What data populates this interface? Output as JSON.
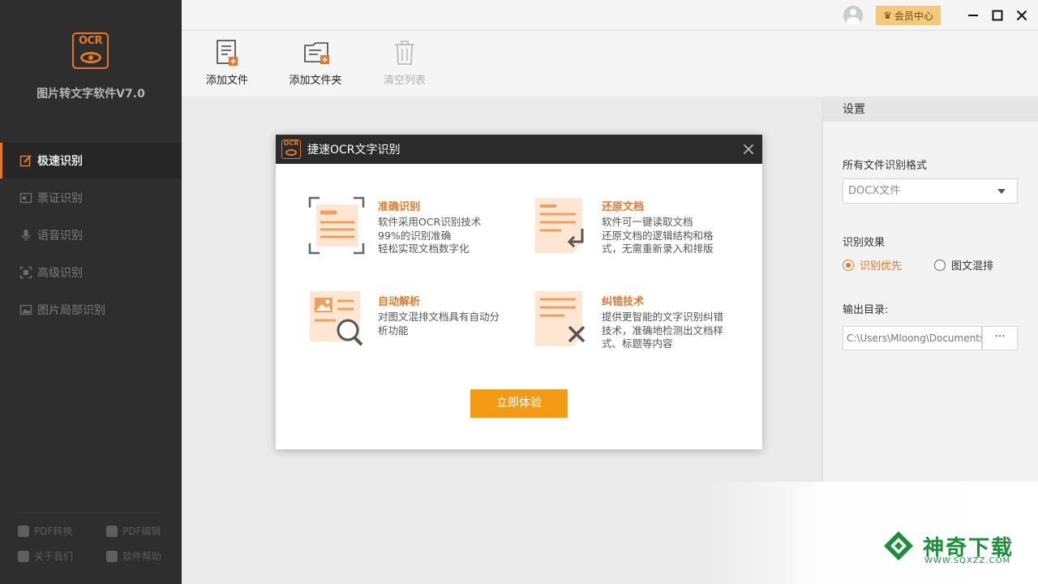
{
  "app": {
    "logo_text": "OCR",
    "name": "图片转文字软件V7.0"
  },
  "sidebar": {
    "items": [
      {
        "label": "极速识别",
        "icon": "fast-recognize-icon",
        "active": true
      },
      {
        "label": "票证识别",
        "icon": "ticket-icon",
        "active": false
      },
      {
        "label": "语音识别",
        "icon": "microphone-icon",
        "active": false
      },
      {
        "label": "高级识别",
        "icon": "advanced-icon",
        "active": false
      },
      {
        "label": "图片局部识别",
        "icon": "image-region-icon",
        "active": false
      }
    ],
    "bottom_links": [
      {
        "label": "PDF转换",
        "icon": "pdf-convert-icon"
      },
      {
        "label": "PDF编辑",
        "icon": "pdf-edit-icon"
      },
      {
        "label": "关于我们",
        "icon": "about-icon"
      },
      {
        "label": "软件帮助",
        "icon": "help-icon"
      }
    ]
  },
  "titlebar": {
    "member_label": "会员中心",
    "minimize": "—",
    "maximize": "□",
    "close": "✕"
  },
  "toolbar": {
    "add_file": "添加文件",
    "add_folder": "添加文件夹",
    "clear_list": "清空列表"
  },
  "settings": {
    "header": "设置",
    "format_label": "所有文件识别格式",
    "format_value": "DOCX文件",
    "effect_label": "识别效果",
    "effect_options": [
      "识别优先",
      "图文混排"
    ],
    "effect_selected": "识别优先",
    "output_label": "输出目录:",
    "output_path": "C:\\Users\\Mloong\\Documents",
    "browse_label": "···"
  },
  "dialog": {
    "logo_text": "OCR",
    "title": "捷速OCR文字识别",
    "features": [
      {
        "title": "准确识别",
        "desc": "软件采用OCR识别技术\n99%的识别准确\n轻松实现文档数字化"
      },
      {
        "title": "还原文档",
        "desc": "软件可一键读取文档\n还原文档的逻辑结构和格式，无需重新录入和排版"
      },
      {
        "title": "自动解析",
        "desc": "对图文混排文档具有自动分析功能"
      },
      {
        "title": "纠错技术",
        "desc": "提供更智能的文字识别纠错技术，准确地检测出文档样式、标题等内容"
      }
    ],
    "button": "立即体验"
  },
  "watermark": {
    "text": "神奇下载",
    "url": "WWW.SQXZZ.COM"
  },
  "colors": {
    "accent": "#e3782b",
    "button": "#f39a15",
    "sidebar_bg": "#2e2e2e",
    "watermark": "#1d8d3b"
  }
}
